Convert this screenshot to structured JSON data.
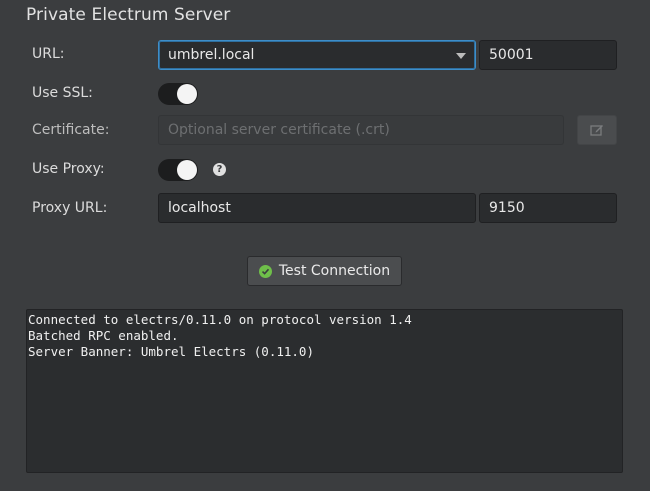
{
  "title": "Private Electrum Server",
  "url": {
    "label": "URL:",
    "host": "umbrel.local",
    "port": "50001"
  },
  "ssl": {
    "label": "Use SSL:",
    "enabled": false
  },
  "certificate": {
    "label": "Certificate:",
    "placeholder": "Optional server certificate (.crt)",
    "button_icon": "edit-icon"
  },
  "proxy": {
    "label": "Use Proxy:",
    "enabled": false,
    "help_icon": "?"
  },
  "proxy_url": {
    "label": "Proxy URL:",
    "host": "localhost",
    "port": "9150"
  },
  "test_button": {
    "label": "Test Connection",
    "icon": "check-circle-icon"
  },
  "output_lines": [
    "Connected to electrs/0.11.0 on protocol version 1.4",
    "Batched RPC enabled.",
    "Server Banner: Umbrel Electrs (0.11.0)"
  ],
  "colors": {
    "accent": "#3d8ec9",
    "success": "#6fbf4a"
  }
}
